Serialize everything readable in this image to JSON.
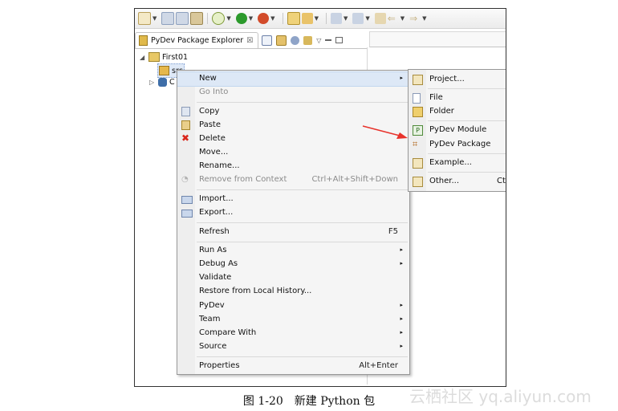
{
  "panel": {
    "title": "PyDev Package Explorer",
    "close_glyph": "☒"
  },
  "tree": {
    "project": "First01",
    "src": "src",
    "other": "C"
  },
  "context_menu": {
    "items": [
      {
        "label": "New",
        "accel": "",
        "sub": true,
        "disabled": false
      },
      {
        "label": "Go Into",
        "accel": "",
        "sub": false,
        "disabled": true
      },
      {
        "label": "Copy",
        "accel": "",
        "sub": false,
        "disabled": false
      },
      {
        "label": "Paste",
        "accel": "",
        "sub": false,
        "disabled": false
      },
      {
        "label": "Delete",
        "accel": "",
        "sub": false,
        "disabled": false
      },
      {
        "label": "Move...",
        "accel": "",
        "sub": false,
        "disabled": false
      },
      {
        "label": "Rename...",
        "accel": "",
        "sub": false,
        "disabled": false
      },
      {
        "label": "Remove from Context",
        "accel": "Ctrl+Alt+Shift+Down",
        "sub": false,
        "disabled": true
      },
      {
        "label": "Import...",
        "accel": "",
        "sub": false,
        "disabled": false
      },
      {
        "label": "Export...",
        "accel": "",
        "sub": false,
        "disabled": false
      },
      {
        "label": "Refresh",
        "accel": "F5",
        "sub": false,
        "disabled": false
      },
      {
        "label": "Run As",
        "accel": "",
        "sub": true,
        "disabled": false
      },
      {
        "label": "Debug As",
        "accel": "",
        "sub": true,
        "disabled": false
      },
      {
        "label": "Validate",
        "accel": "",
        "sub": false,
        "disabled": false
      },
      {
        "label": "Restore from Local History...",
        "accel": "",
        "sub": false,
        "disabled": false
      },
      {
        "label": "PyDev",
        "accel": "",
        "sub": true,
        "disabled": false
      },
      {
        "label": "Team",
        "accel": "",
        "sub": true,
        "disabled": false
      },
      {
        "label": "Compare With",
        "accel": "",
        "sub": true,
        "disabled": false
      },
      {
        "label": "Source",
        "accel": "",
        "sub": true,
        "disabled": false
      },
      {
        "label": "Properties",
        "accel": "Alt+Enter",
        "sub": false,
        "disabled": false
      }
    ],
    "submenu_glyph": "▸"
  },
  "new_submenu": {
    "items": [
      {
        "label": "Project..."
      },
      {
        "label": "File"
      },
      {
        "label": "Folder"
      },
      {
        "label": "PyDev Module"
      },
      {
        "label": "PyDev Package"
      },
      {
        "label": "Example..."
      },
      {
        "label": "Other...",
        "accel": "Ctr"
      }
    ]
  },
  "caption": "图 1-20　新建 Python 包",
  "watermark": "云栖社区 yq.aliyun.com",
  "colors": {
    "highlight": "#dde8f6",
    "annotation_arrow": "#e8322b",
    "delete_icon": "#d9261c"
  }
}
